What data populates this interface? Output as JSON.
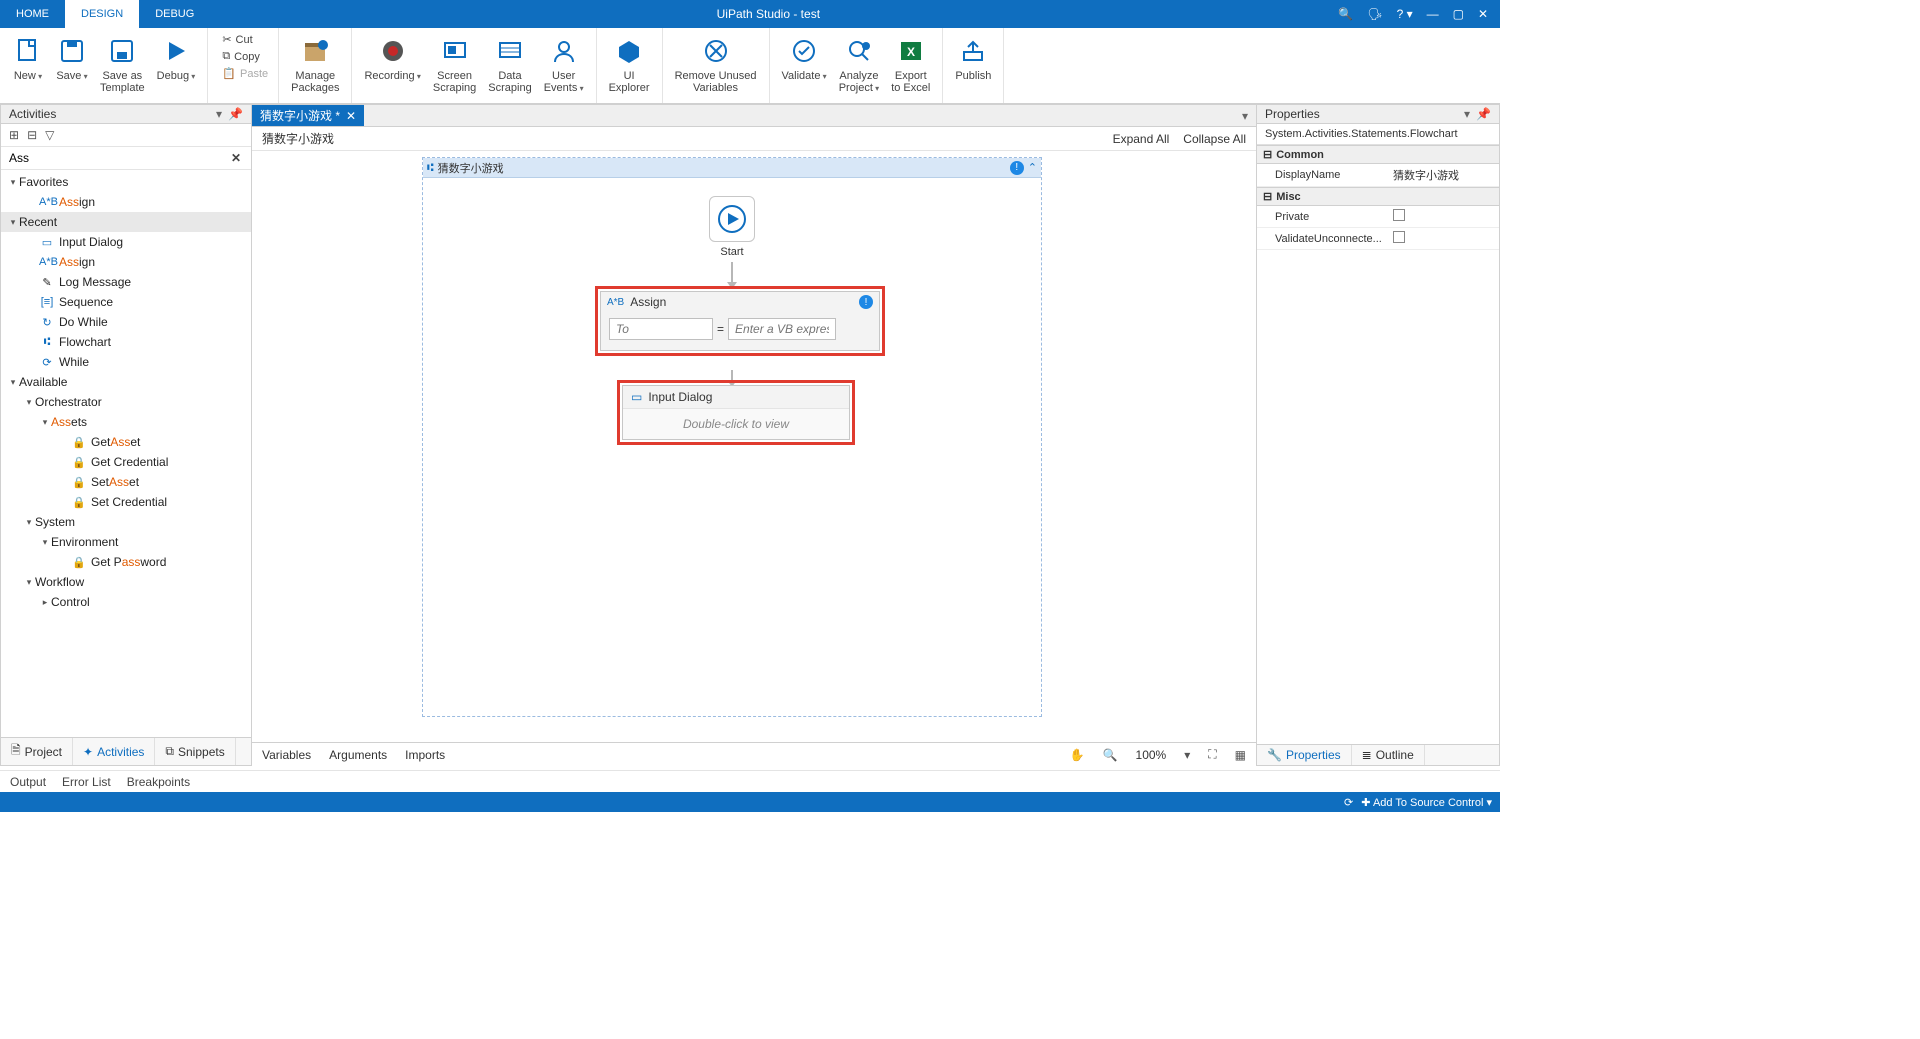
{
  "window": {
    "title": "UiPath Studio - test"
  },
  "tabs": {
    "home": "HOME",
    "design": "DESIGN",
    "debug": "DEBUG"
  },
  "ribbon": {
    "new": "New",
    "save": "Save",
    "save_tpl": "Save as\nTemplate",
    "debug": "Debug",
    "cut": "Cut",
    "copy": "Copy",
    "paste": "Paste",
    "manage_pkg": "Manage\nPackages",
    "recording": "Recording",
    "screen_scrape": "Screen\nScraping",
    "data_scrape": "Data\nScraping",
    "user_events": "User\nEvents",
    "ui_explorer": "UI\nExplorer",
    "remove_unused": "Remove Unused\nVariables",
    "validate": "Validate",
    "analyze": "Analyze\nProject",
    "export_excel": "Export\nto Excel",
    "publish": "Publish"
  },
  "activities": {
    "title": "Activities",
    "search": "Ass",
    "favorites": "Favorites",
    "fav_assign_pre": "Ass",
    "fav_assign_post": "ign",
    "recent": "Recent",
    "recent_items": {
      "input_dialog": "Input Dialog",
      "assign_pre": "Ass",
      "assign_post": "ign",
      "log_message": "Log Message",
      "sequence": "Sequence",
      "do_while": "Do While",
      "flowchart": "Flowchart",
      "while": "While"
    },
    "available": "Available",
    "orchestrator": "Orchestrator",
    "assets_pre": "Ass",
    "assets_post": "ets",
    "get_asset_pre": "Get ",
    "get_asset_hl": "Ass",
    "get_asset_post": "et",
    "get_credential": "Get Credential",
    "set_asset_pre": "Set ",
    "set_asset_hl": "Ass",
    "set_asset_post": "et",
    "set_credential": "Set Credential",
    "system": "System",
    "environment": "Environment",
    "get_password_pre": "Get P",
    "get_password_hl": "ass",
    "get_password_post": "word",
    "workflow": "Workflow",
    "control": "Control",
    "tabs": {
      "project": "Project",
      "activities": "Activities",
      "snippets": "Snippets"
    }
  },
  "doc": {
    "tab": "猜数字小游戏 *",
    "breadcrumb": "猜数字小游戏",
    "expand_all": "Expand All",
    "collapse_all": "Collapse All"
  },
  "flow": {
    "title": "猜数字小游戏",
    "start": "Start",
    "assign": "Assign",
    "to_ph": "To",
    "expr_ph": "Enter a VB expres",
    "input_dialog": "Input Dialog",
    "dbl": "Double-click to view"
  },
  "center_bottom": {
    "variables": "Variables",
    "arguments": "Arguments",
    "imports": "Imports",
    "zoom": "100%"
  },
  "props": {
    "title": "Properties",
    "type": "System.Activities.Statements.Flowchart",
    "cat_common": "Common",
    "display_name_k": "DisplayName",
    "display_name_v": "猜数字小游戏",
    "cat_misc": "Misc",
    "private": "Private",
    "validate_un": "ValidateUnconnecte...",
    "tabs": {
      "properties": "Properties",
      "outline": "Outline"
    }
  },
  "bottom": {
    "output": "Output",
    "error_list": "Error List",
    "breakpoints": "Breakpoints"
  },
  "status": {
    "add_src": "Add To Source Control"
  }
}
